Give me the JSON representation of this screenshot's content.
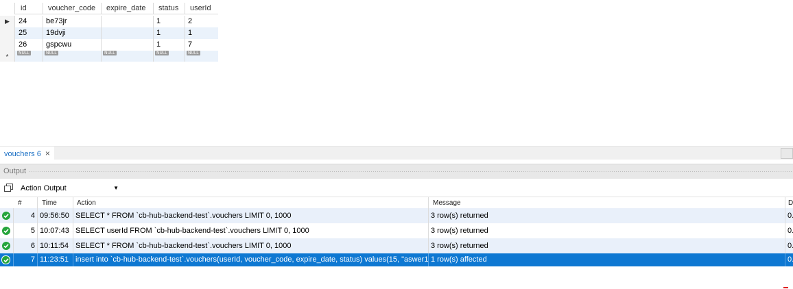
{
  "result_grid": {
    "columns": [
      "id",
      "voucher_code",
      "expire_date",
      "status",
      "userId"
    ],
    "rows": [
      {
        "id": "24",
        "voucher_code": "be73jr",
        "expire_date": "",
        "status": "1",
        "userId": "2"
      },
      {
        "id": "25",
        "voucher_code": "19dvji",
        "expire_date": "",
        "status": "1",
        "userId": "1"
      },
      {
        "id": "26",
        "voucher_code": "gspcwu",
        "expire_date": "",
        "status": "1",
        "userId": "7"
      }
    ],
    "new_row_marker": "*",
    "current_row_marker": "▶",
    "null_label": "NULL"
  },
  "tab": {
    "label": "vouchers 6",
    "close": "×"
  },
  "output": {
    "title": "Output",
    "view_select": "Action Output",
    "columns": [
      "#",
      "Time",
      "Action",
      "Message",
      "D"
    ],
    "rows": [
      {
        "num": "4",
        "time": "09:56:50",
        "action": "SELECT * FROM `cb-hub-backend-test`.vouchers LIMIT 0, 1000",
        "message": "3 row(s) returned",
        "duration": "0.",
        "status": "ok"
      },
      {
        "num": "5",
        "time": "10:07:43",
        "action": "SELECT userId FROM `cb-hub-backend-test`.vouchers LIMIT 0, 1000",
        "message": "3 row(s) returned",
        "duration": "0.",
        "status": "ok"
      },
      {
        "num": "6",
        "time": "10:11:54",
        "action": "SELECT * FROM `cb-hub-backend-test`.vouchers LIMIT 0, 1000",
        "message": "3 row(s) returned",
        "duration": "0.",
        "status": "ok"
      },
      {
        "num": "7",
        "time": "11:23:51",
        "action": "insert into `cb-hub-backend-test`.vouchers(userId, voucher_code, expire_date, status) values(15, \"aswer1...",
        "message": "1 row(s) affected",
        "duration": "0.",
        "status": "ok",
        "selected": true
      }
    ]
  },
  "colors": {
    "selection": "#0e78d2",
    "alt_row": "#e9f0fa",
    "success": "#25a53c",
    "tab_text": "#1a6fc4"
  }
}
